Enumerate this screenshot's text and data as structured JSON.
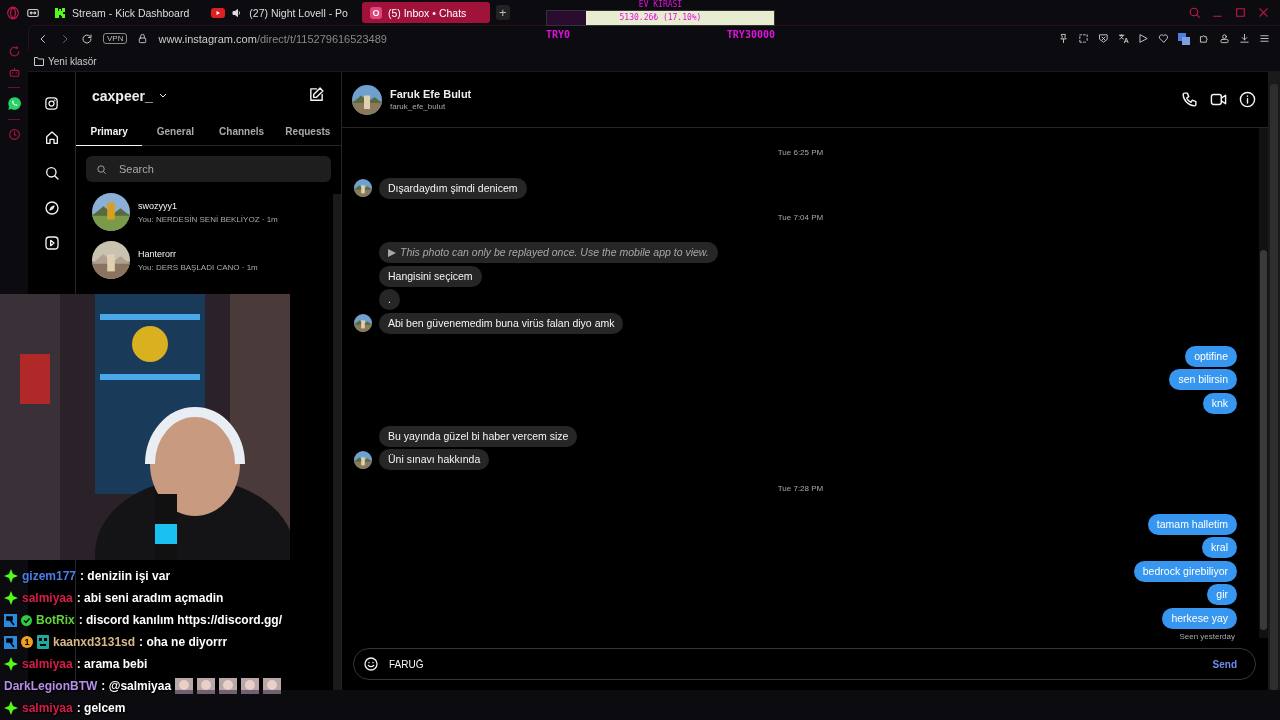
{
  "browser": {
    "tabs": [
      {
        "kind": "kick",
        "title": "Stream - Kick Dashboard",
        "selected": false,
        "audio": false
      },
      {
        "kind": "youtube",
        "title": "(27) Night Lovell - Po",
        "selected": false,
        "audio": true
      },
      {
        "kind": "instagram",
        "title": "(5) Inbox • Chats",
        "selected": true,
        "audio": false
      }
    ],
    "new_tab": "+",
    "vpn": "VPN",
    "url_domain": "www.instagram.com",
    "url_path": "/direct/t/115279616523489",
    "bookmarks": [
      {
        "label": "Yeni klasör"
      }
    ]
  },
  "goal_widget": {
    "title": "EV KİRASI",
    "amount": "5130.26₺ (17.10%)",
    "level": 0.171,
    "min": "TRY0",
    "max": "TRY30000"
  },
  "inbox": {
    "username": "caxpeer_",
    "tabs": [
      {
        "label": "Primary",
        "selected": true
      },
      {
        "label": "General",
        "selected": false
      },
      {
        "label": "Channels",
        "selected": false
      },
      {
        "label": "Requests",
        "selected": false
      }
    ],
    "search": {
      "placeholder": "Search"
    },
    "conversations": [
      {
        "name": "swozyyy1",
        "preview": "You: NERDESİN SENİ BEKLİYOZ · 1m"
      },
      {
        "name": "Hanterorr",
        "preview": "You: DERS BAŞLADI CANO · 1m"
      }
    ]
  },
  "chat": {
    "name": "Faruk Efe Bulut",
    "handle": "faruk_efe_bulut",
    "messages": [
      {
        "kind": "time",
        "text": "Tue 6:25 PM"
      },
      {
        "kind": "in",
        "text": "Dışardaydım şimdi denicem",
        "avatar": true
      },
      {
        "kind": "time",
        "text": "Tue 7:04 PM"
      },
      {
        "kind": "note",
        "text": "This photo can only be replayed once. Use the mobile app to view."
      },
      {
        "kind": "in",
        "text": "Hangisini seçicem",
        "avatar": false
      },
      {
        "kind": "in",
        "text": ".",
        "avatar": false
      },
      {
        "kind": "in",
        "text": "Abi ben güvenemedim buna virüs falan diyo amk",
        "avatar": true
      },
      {
        "kind": "out",
        "text": "optifine"
      },
      {
        "kind": "out",
        "text": "sen bilirsin"
      },
      {
        "kind": "out",
        "text": "knk"
      },
      {
        "kind": "in",
        "text": "Bu yayında güzel bi haber vercem size",
        "avatar": false
      },
      {
        "kind": "in",
        "text": "Üni sınavı hakkında",
        "avatar": true
      },
      {
        "kind": "time",
        "text": "Tue 7:28 PM"
      },
      {
        "kind": "out",
        "text": "tamam halletim"
      },
      {
        "kind": "out",
        "text": "kral"
      },
      {
        "kind": "out",
        "text": "bedrock girebiliyor"
      },
      {
        "kind": "out",
        "text": "gir"
      },
      {
        "kind": "out",
        "text": "herkese yay"
      },
      {
        "kind": "seen",
        "text": "Seen yesterday"
      }
    ],
    "composer": {
      "value": "FARUĞ",
      "send": "Send"
    }
  },
  "stream_chat": [
    {
      "badges": [
        {
          "kind": "sub"
        }
      ],
      "user": "gizem177",
      "color": "#4b7fe6",
      "text": ": deniziin işi var"
    },
    {
      "badges": [
        {
          "kind": "sub"
        }
      ],
      "user": "salmiyaa",
      "color": "#d81b4a",
      "text": ": abi seni aradım açmadin"
    },
    {
      "badges": [
        {
          "kind": "mod"
        },
        {
          "kind": "verified"
        }
      ],
      "user": "BotRix",
      "color": "#5fd33a",
      "text": ": discord kanılım https://discord.gg/"
    },
    {
      "badges": [
        {
          "kind": "mod"
        },
        {
          "kind": "gift",
          "label": "1"
        },
        {
          "kind": "bot"
        }
      ],
      "user": "kaanxd3131sd",
      "color": "#d9b98a",
      "text": ": oha ne diyorrr"
    },
    {
      "badges": [
        {
          "kind": "sub"
        }
      ],
      "user": "salmiyaa",
      "color": "#d81b4a",
      "text": ": arama bebi"
    },
    {
      "user": "DarkLegionBTW",
      "color": "#b58de8",
      "text": ": @salmiyaa"
    },
    {
      "badges": [
        {
          "kind": "sub"
        }
      ],
      "user": "salmiyaa",
      "color": "#d81b4a",
      "text": ": gelcem"
    }
  ]
}
